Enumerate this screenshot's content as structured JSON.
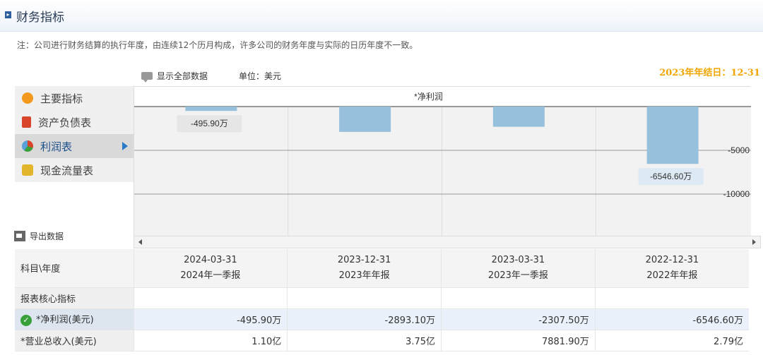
{
  "header": {
    "title": "财务指标"
  },
  "note": "注：公司进行财务结算的执行年度，由连续12个历月构成，许多公司的财务年度与实际的日历年度不一致。",
  "year_end": "2023年年结日：12-31",
  "toolbar": {
    "show_all_label": "显示全部数据",
    "unit_label": "单位：美元"
  },
  "sidebar": {
    "items": [
      {
        "label": "主要指标",
        "icon": "gear-flower-icon",
        "color": "#f39a1e",
        "active": false
      },
      {
        "label": "资产负债表",
        "icon": "document-icon",
        "color": "#d9452b",
        "active": false
      },
      {
        "label": "利润表",
        "icon": "pie-chart-icon",
        "color": "#5aa0d8",
        "active": true
      },
      {
        "label": "现金流量表",
        "icon": "coins-icon",
        "color": "#e3b52b",
        "active": false
      }
    ]
  },
  "export_label": "导出数据",
  "chart_data": {
    "type": "bar",
    "title": "*净利润",
    "categories": [
      "2024-03-31",
      "2023-12-31",
      "2023-03-31",
      "2022-12-31"
    ],
    "values": [
      -495.9,
      -2893.1,
      -2307.5,
      -6546.6
    ],
    "unit": "万",
    "ylim": [
      -15000,
      0
    ],
    "yticks": [
      -5000,
      -10000
    ],
    "ytick_labels": [
      "-5000",
      "-10000"
    ],
    "data_labels": [
      "-495.90万",
      "",
      "",
      "-6546.60万"
    ],
    "bar_color": "#97c0dc",
    "grid": true
  },
  "table": {
    "header_label": "科目\\年度",
    "columns": [
      {
        "date": "2024-03-31",
        "report": "2024年一季报"
      },
      {
        "date": "2023-12-31",
        "report": "2023年年报"
      },
      {
        "date": "2023-03-31",
        "report": "2023年一季报"
      },
      {
        "date": "2022-12-31",
        "report": "2022年年报"
      }
    ],
    "section_label": "报表核心指标",
    "rows": [
      {
        "label": "*净利润(美元)",
        "values": [
          "-495.90万",
          "-2893.10万",
          "-2307.50万",
          "-6546.60万"
        ]
      },
      {
        "label": "*营业总收入(美元)",
        "values": [
          "1.10亿",
          "3.75亿",
          "7881.90万",
          "2.79亿"
        ]
      }
    ]
  }
}
